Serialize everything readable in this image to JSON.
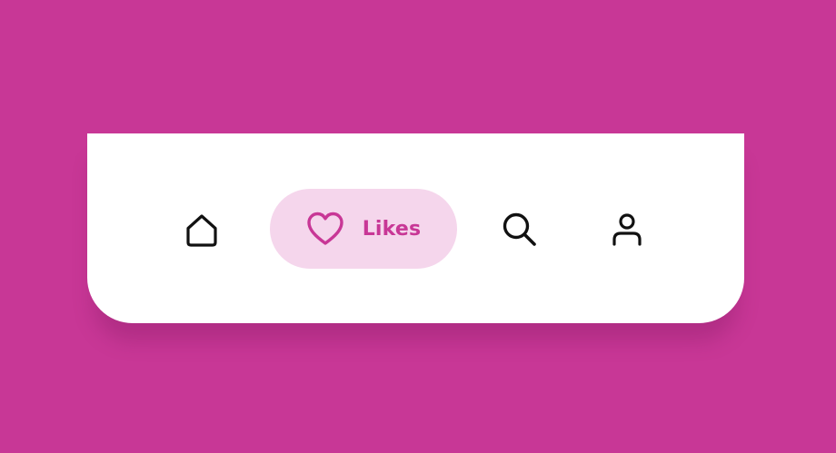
{
  "colors": {
    "background": "#c83796",
    "bar": "#ffffff",
    "active_pill": "#f5d6ec",
    "active_accent": "#c83796",
    "icon": "#111111"
  },
  "nav": {
    "active": "likes",
    "items": [
      {
        "id": "home",
        "icon": "home-icon",
        "label": ""
      },
      {
        "id": "likes",
        "icon": "heart-icon",
        "label": "Likes"
      },
      {
        "id": "search",
        "icon": "search-icon",
        "label": ""
      },
      {
        "id": "profile",
        "icon": "user-icon",
        "label": ""
      }
    ]
  }
}
